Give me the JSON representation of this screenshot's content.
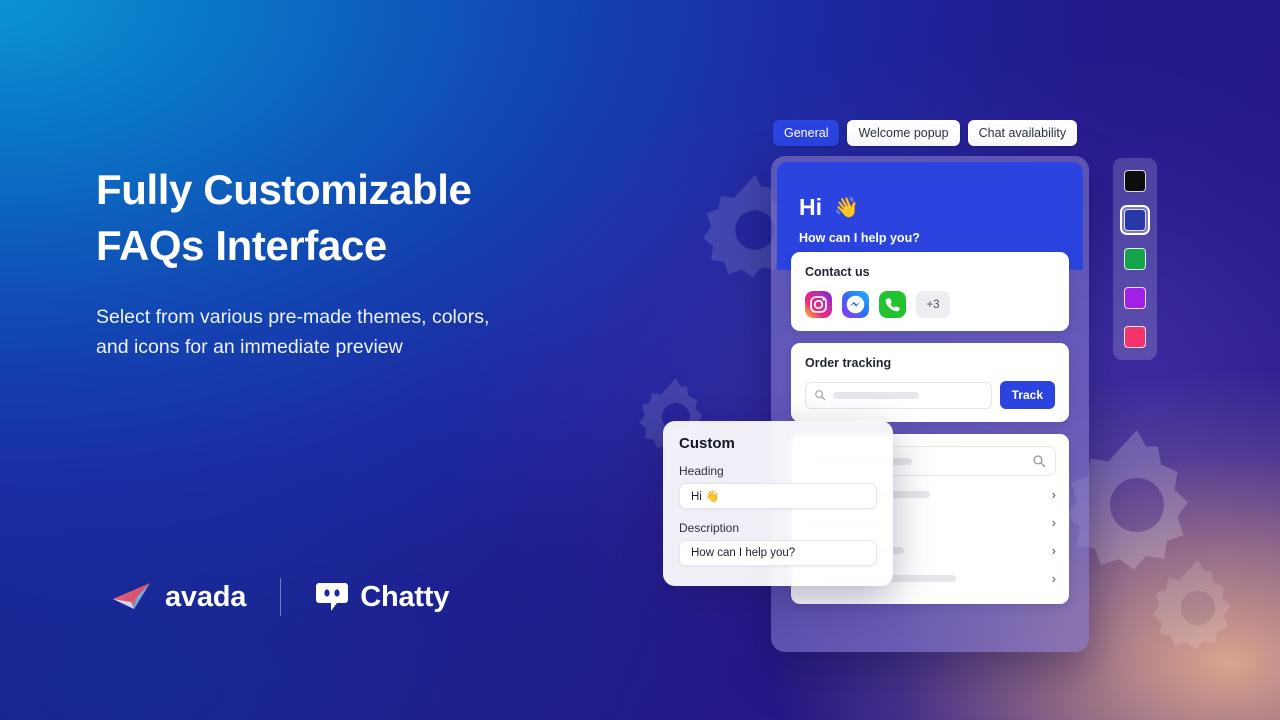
{
  "hero": {
    "headline_line1": "Fully Customizable",
    "headline_line2": "FAQs Interface",
    "subtext": "Select from various pre-made themes, colors, and icons for an immediate preview"
  },
  "brands": {
    "avada": "avada",
    "chatty": "Chatty"
  },
  "tabs": [
    {
      "label": "General",
      "active": true
    },
    {
      "label": "Welcome popup",
      "active": false
    },
    {
      "label": "Chat availability",
      "active": false
    }
  ],
  "widget": {
    "header": {
      "greeting": "Hi",
      "wave_emoji": "👋",
      "subtitle": "How can I help you?"
    },
    "contact_card": {
      "title": "Contact us",
      "channels": [
        "instagram-icon",
        "messenger-icon",
        "phone-icon"
      ],
      "more_label": "+3"
    },
    "order_card": {
      "title": "Order tracking",
      "search_icon": "search-icon",
      "button_label": "Track"
    },
    "faq_card": {
      "search_icon": "search-icon",
      "row_count": 4,
      "chevron": "›"
    }
  },
  "custom_panel": {
    "title": "Custom",
    "heading_label": "Heading",
    "heading_value": "Hi 👋",
    "description_label": "Description",
    "description_value": "How can I help you?"
  },
  "palette": {
    "swatches": [
      {
        "name": "black",
        "color": "#0d0d0d",
        "selected": false
      },
      {
        "name": "blue",
        "color": "#2838a8",
        "selected": true
      },
      {
        "name": "green",
        "color": "#16a34a",
        "selected": false
      },
      {
        "name": "purple",
        "color": "#a020e8",
        "selected": false
      },
      {
        "name": "pink",
        "color": "#f4336b",
        "selected": false
      }
    ]
  },
  "colors": {
    "accent_blue": "#2b44e0",
    "frame_purple": "#7e74c8"
  }
}
